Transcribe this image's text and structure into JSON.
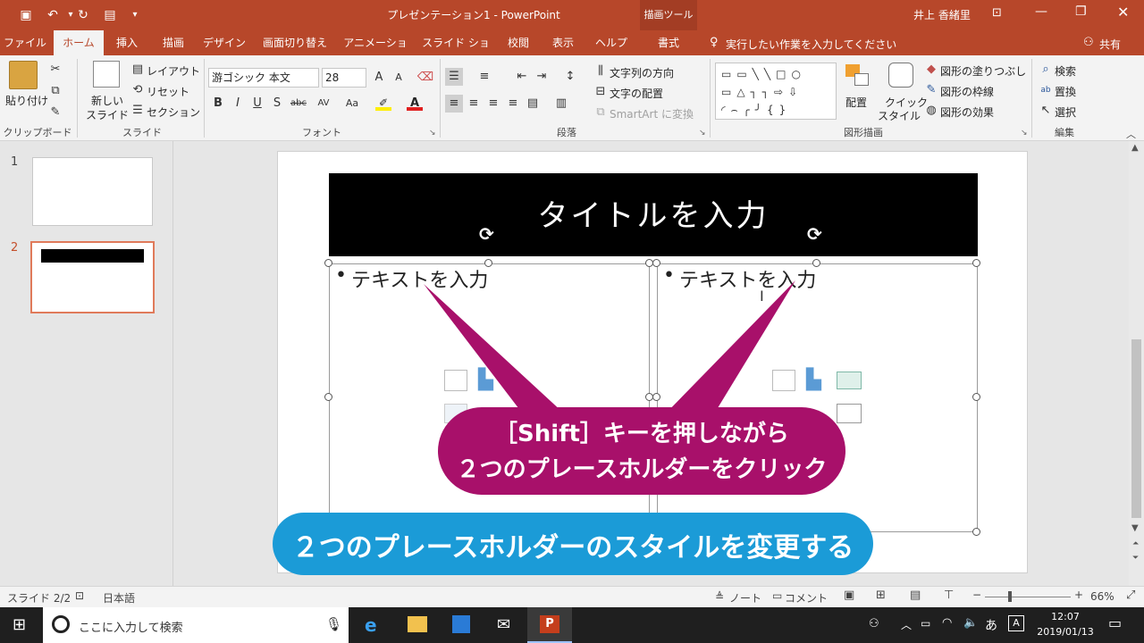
{
  "window": {
    "title": "プレゼンテーション1 - PowerPoint",
    "context_tab_group": "描画ツール",
    "user": "井上 香緒里"
  },
  "tabs": [
    {
      "label": "ファイル"
    },
    {
      "label": "ホーム"
    },
    {
      "label": "挿入"
    },
    {
      "label": "描画"
    },
    {
      "label": "デザイン"
    },
    {
      "label": "画面切り替え"
    },
    {
      "label": "アニメーション"
    },
    {
      "label": "スライド ショー"
    },
    {
      "label": "校閲"
    },
    {
      "label": "表示"
    },
    {
      "label": "ヘルプ"
    },
    {
      "label": "書式"
    }
  ],
  "active_tab": "ホーム",
  "tell_me": "実行したい作業を入力してください",
  "share": "共有",
  "ribbon": {
    "clipboard": {
      "paste": "貼り付け",
      "group": "クリップボード"
    },
    "slides": {
      "new_slide": "新しい",
      "new_slide2": "スライド",
      "layout": "レイアウト",
      "reset": "リセット",
      "section": "セクション",
      "group": "スライド"
    },
    "font": {
      "name": "游ゴシック 本文",
      "size": "28",
      "group": "フォント",
      "bold": "B",
      "italic": "I",
      "underline": "U",
      "shadow": "S",
      "strike": "abc",
      "spacing": "AV",
      "case": "Aa"
    },
    "paragraph": {
      "text_direction": "文字列の方向",
      "align_text": "文字の配置",
      "smartart": "SmartArt に変換",
      "group": "段落"
    },
    "drawing": {
      "arrange": "配置",
      "quick_styles": "クイック",
      "quick_styles2": "スタイル",
      "fill": "図形の塗りつぶし",
      "outline": "図形の枠線",
      "effects": "図形の効果",
      "group": "図形描画"
    },
    "editing": {
      "find": "検索",
      "replace": "置換",
      "select": "選択",
      "group": "編集"
    }
  },
  "slide_panel": [
    {
      "num": "1"
    },
    {
      "num": "2"
    }
  ],
  "slide": {
    "title": "タイトルを入力",
    "left_bullet": "テキストを入力",
    "right_bullet": "テキストを入力"
  },
  "callouts": {
    "magenta_line1": "［Shift］キーを押しながら",
    "magenta_line2": "２つのプレースホルダーをクリック",
    "blue": "２つのプレースホルダーのスタイルを変更する",
    "magenta_color": "#a8106a",
    "blue_color": "#1b9bd7"
  },
  "status": {
    "slide_count": "スライド 2/2",
    "language": "日本語",
    "notes": "ノート",
    "comments": "コメント",
    "zoom": "66%"
  },
  "taskbar": {
    "search": "ここに入力して検索",
    "time": "12:07",
    "date": "2019/01/13",
    "ime": "あ"
  },
  "colors": {
    "accent": "#b7472a"
  }
}
